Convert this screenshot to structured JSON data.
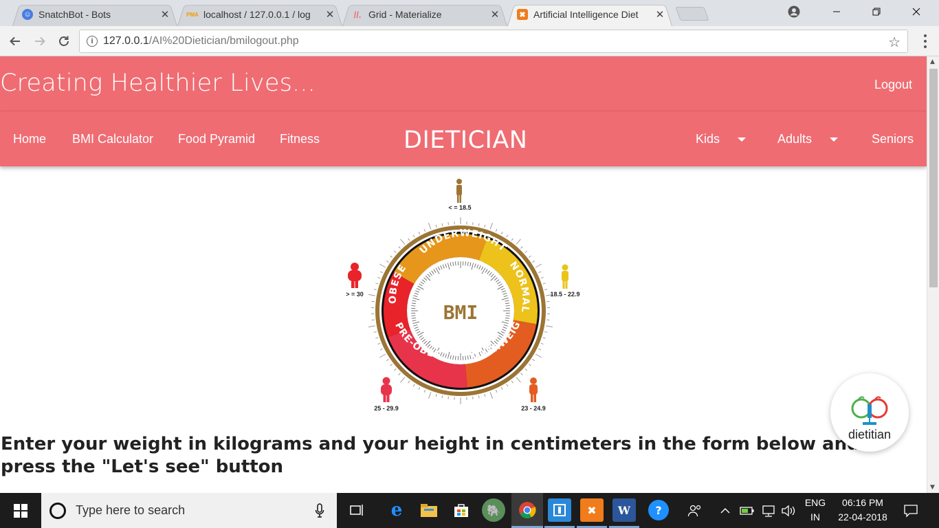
{
  "browser": {
    "tabs": [
      {
        "title": "SnatchBot - Bots",
        "favicon": "snatchbot-icon",
        "color": "#4a7de0"
      },
      {
        "title": "localhost / 127.0.0.1 / log",
        "favicon": "phpmyadmin-icon",
        "color": "#f59a00"
      },
      {
        "title": "Grid - Materialize",
        "favicon": "materialize-icon",
        "color": "#ee6e73"
      },
      {
        "title": "Artificial Intelligence Diet",
        "favicon": "xampp-icon",
        "color": "#f07c1c"
      }
    ],
    "url_host": "127.0.0.1",
    "url_path": "/AI%20Dietician/bmilogout.php"
  },
  "site": {
    "title": "Creating Healthier Lives...",
    "logout": "Logout",
    "brand": "DIETICIAN",
    "nav_left": [
      "Home",
      "BMI Calculator",
      "Food Pyramid",
      "Fitness"
    ],
    "nav_right": {
      "kids": "Kids",
      "adults": "Adults",
      "seniors": "Seniors"
    },
    "accent": "#ef6c73"
  },
  "bmi_wheel": {
    "center_label": "BMI",
    "segments": [
      {
        "label": "UNDERWEIGHT",
        "color": "#e6961a"
      },
      {
        "label": "NORMAL",
        "color": "#ecc21b"
      },
      {
        "label": "OVERWEIGHT",
        "color": "#e35d20"
      },
      {
        "label": "PRE-OBESE",
        "color": "#e8344b"
      },
      {
        "label": "OBESE",
        "color": "#e8232a"
      }
    ],
    "figures": [
      {
        "range": "< = 18.5",
        "color": "#9c7535"
      },
      {
        "range": "18.5 - 22.9",
        "color": "#e8c51a"
      },
      {
        "range": "23 - 24.9",
        "color": "#e35d20"
      },
      {
        "range": "25 - 29.9",
        "color": "#e8344b"
      },
      {
        "range": "> = 30",
        "color": "#e8232a"
      }
    ]
  },
  "instructions": "Enter your weight in kilograms and your height in centimeters in the form below and press the \"Let's see\" button",
  "chatbot": {
    "label": "dietitian"
  },
  "taskbar": {
    "search_placeholder": "Type here to search",
    "lang_top": "ENG",
    "lang_bottom": "IN",
    "time": "06:16 PM",
    "date": "22-04-2018"
  }
}
